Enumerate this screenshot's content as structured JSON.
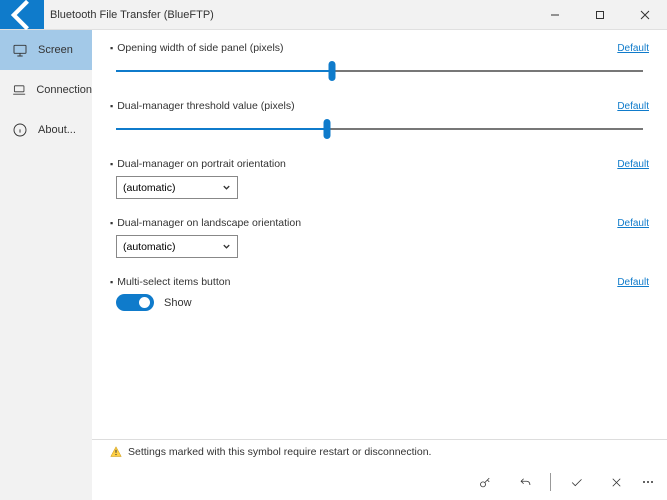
{
  "window": {
    "title": "Bluetooth File Transfer (BlueFTP)"
  },
  "sidebar": {
    "items": [
      {
        "label": "Screen"
      },
      {
        "label": "Connection"
      },
      {
        "label": "About..."
      }
    ]
  },
  "settings": {
    "s1": {
      "label": "Opening width of side panel (pixels)",
      "default": "Default",
      "pct": 41
    },
    "s2": {
      "label": "Dual-manager threshold value (pixels)",
      "default": "Default",
      "pct": 40
    },
    "s3": {
      "label": "Dual-manager on portrait orientation",
      "default": "Default",
      "value": "(automatic)"
    },
    "s4": {
      "label": "Dual-manager on landscape orientation",
      "default": "Default",
      "value": "(automatic)"
    },
    "s5": {
      "label": "Multi-select items button",
      "default": "Default",
      "toggle": "Show"
    }
  },
  "footer": {
    "warning": "Settings marked with this symbol require restart or disconnection."
  }
}
